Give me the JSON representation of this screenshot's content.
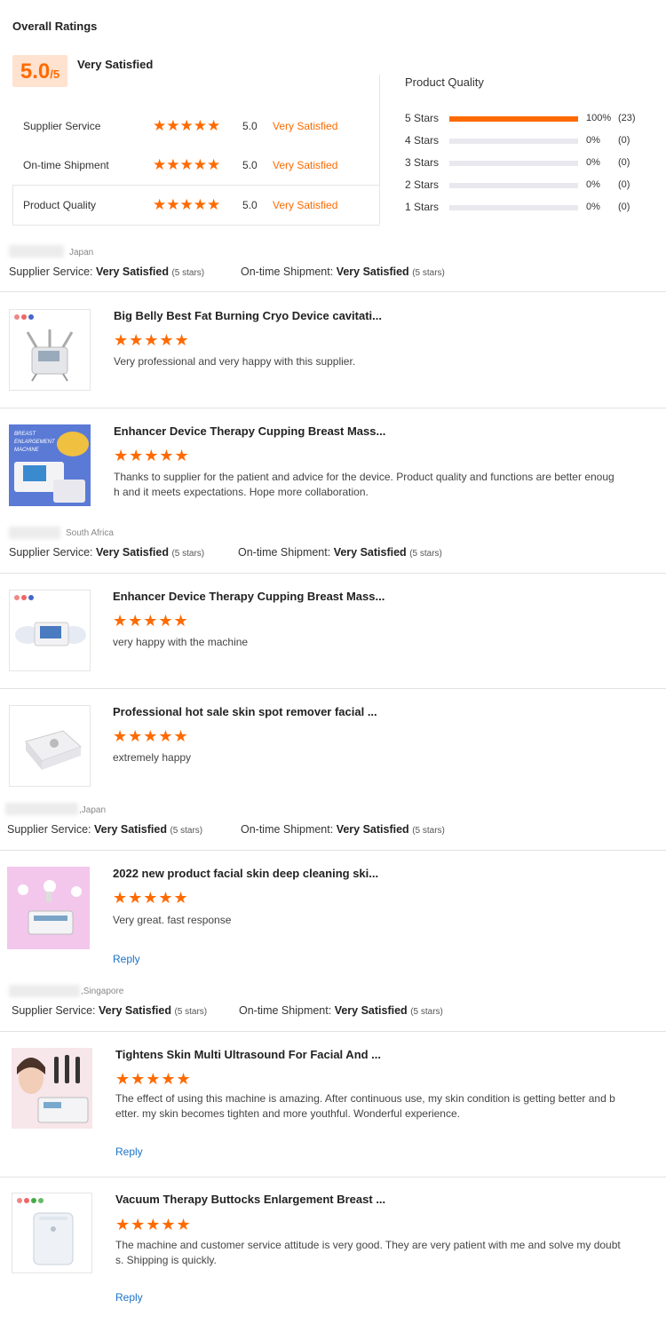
{
  "overall": {
    "heading": "Overall Ratings",
    "score": "5.0",
    "score_suffix": "/5",
    "label": "Very Satisfied",
    "rows": [
      {
        "label": "Supplier Service",
        "stars": "★★★★★",
        "score": "5.0",
        "sat": "Very Satisfied"
      },
      {
        "label": "On-time Shipment",
        "stars": "★★★★★",
        "score": "5.0",
        "sat": "Very Satisfied"
      },
      {
        "label": "Product Quality",
        "stars": "★★★★★",
        "score": "5.0",
        "sat": "Very Satisfied"
      }
    ]
  },
  "breakdown": {
    "title": "Product Quality",
    "rows": [
      {
        "label": "5 Stars",
        "fraction": 1.0,
        "pct": "100%",
        "count": "(23)"
      },
      {
        "label": "4 Stars",
        "fraction": 0,
        "pct": "0%",
        "count": "(0)"
      },
      {
        "label": "3 Stars",
        "fraction": 0,
        "pct": "0%",
        "count": "(0)"
      },
      {
        "label": "2 Stars",
        "fraction": 0,
        "pct": "0%",
        "count": "(0)"
      },
      {
        "label": "1 Stars",
        "fraction": 0,
        "pct": "0%",
        "count": "(0)"
      }
    ]
  },
  "reviewers": [
    {
      "country": "Japan",
      "supplier_label": "Supplier Service:",
      "supplier_value": "Very Satisfied",
      "supplier_stars": "(5 stars)",
      "shipment_label": "On-time Shipment:",
      "shipment_value": "Very Satisfied",
      "shipment_stars": "(5 stars)"
    },
    {
      "country": "South Africa",
      "supplier_label": "Supplier Service:",
      "supplier_value": "Very Satisfied",
      "supplier_stars": "(5 stars)",
      "shipment_label": "On-time Shipment:",
      "shipment_value": "Very Satisfied",
      "shipment_stars": "(5 stars)"
    },
    {
      "country": ",Japan",
      "supplier_label": "Supplier Service:",
      "supplier_value": "Very Satisfied",
      "supplier_stars": "(5 stars)",
      "shipment_label": "On-time Shipment:",
      "shipment_value": "Very Satisfied",
      "shipment_stars": "(5 stars)"
    },
    {
      "country": ",Singapore",
      "supplier_label": "Supplier Service:",
      "supplier_value": "Very Satisfied",
      "supplier_stars": "(5 stars)",
      "shipment_label": "On-time Shipment:",
      "shipment_value": "Very Satisfied",
      "shipment_stars": "(5 stars)"
    }
  ],
  "reviews": [
    {
      "title": "Big Belly Best Fat Burning Cryo Device cavitati...",
      "stars": "★★★★★",
      "text1": "Very professional and very happy with this supplier.",
      "text2": ""
    },
    {
      "title": "Enhancer Device Therapy Cupping Breast Mass...",
      "stars": "★★★★★",
      "text1": "Thanks to supplier for the patient and advice for the device. Product quality and functions are better enoug",
      "text2": "h and it meets expectations. Hope more collaboration.",
      "thumb_text": "BREAST ENLARGEMENT MACHINE"
    },
    {
      "title": "Enhancer Device Therapy Cupping Breast Mass...",
      "stars": "★★★★★",
      "text1": "very happy with the machine",
      "text2": ""
    },
    {
      "title": "Professional hot sale skin spot remover facial ...",
      "stars": "★★★★★",
      "text1": "extremely happy",
      "text2": ""
    },
    {
      "title": "2022 new product facial skin deep cleaning ski...",
      "stars": "★★★★★",
      "text1": "Very great.  fast response",
      "text2": "",
      "reply": "Reply"
    },
    {
      "title": "Tightens Skin Multi Ultrasound For Facial And ...",
      "stars": "★★★★★",
      "text1": "The effect of using this machine is amazing. After continuous use, my skin condition is getting better and b",
      "text2": "etter. my skin becomes tighten and more youthful. Wonderful experience.",
      "reply": "Reply"
    },
    {
      "title": "Vacuum Therapy Buttocks Enlargement Breast ...",
      "stars": "★★★★★",
      "text1": "The machine and customer service attitude is very good. They are very patient with me and solve my doubt",
      "text2": "s.  Shipping is quickly.",
      "reply": "Reply"
    }
  ],
  "colors": {
    "accent": "#ff6a00",
    "link": "#1a73c9",
    "score_bg": "#ffe2cf"
  }
}
